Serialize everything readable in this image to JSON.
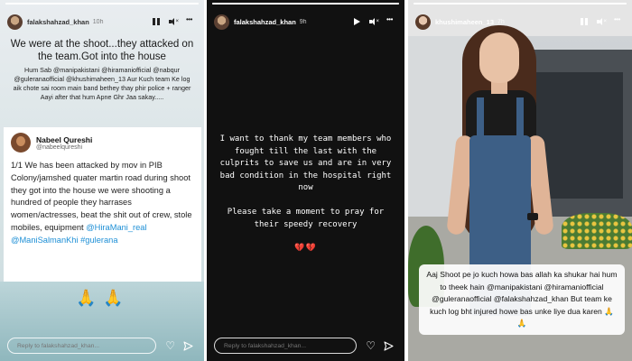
{
  "panel1": {
    "username": "falakshahzad_khan",
    "time": "10h",
    "headline": "We were at the shoot...they attacked on the team.Got into the house",
    "subtext": "Hum Sab @manipakistani @hiramaniofficial @nabqur @guleranaofficial @khushimaheen_13 Aur Kuch team Ke log aik chote sai room main band bethey thay phir police + ranger Aayi after that hum Apne Ghr Jaa sakay.....",
    "tweet": {
      "name": "Nabeel Qureshi",
      "handle": "@nabeelqureshi",
      "body": "1/1 We has been attacked by mov in PIB Colony/jamshed quater martin road during shoot they got into the house we were shooting a hundred of people they harrases women/actresses, beat the shit out of crew, stole mobiles, equipment",
      "mentions": "@HiraMani_real @ManiSalmanKhi #gulerana"
    },
    "emoji": "🙏🙏",
    "reply_placeholder": "Reply to falakshahzad_khan..."
  },
  "panel2": {
    "username": "falakshahzad_khan",
    "time": "9h",
    "para1": "I want to thank my team members who fought till the last with the culprits to save us and are in very bad condition in the hospital right now",
    "para2": "Please take a moment to pray for their speedy recovery",
    "hearts": "💔💔",
    "reply_placeholder": "Reply to falakshahzad_khan..."
  },
  "panel3": {
    "username": "khushimaheen_13",
    "time": "7h",
    "caption": "Aaj Shoot pe jo kuch howa bas allah ka shukar hai hum to theek hain @manipakistani @hiramaniofficial @guleranaofficial @falakshahzad_khan But team ke kuch log bht injured howe bas unke liye dua karen",
    "caption_emoji": "🙏🙏",
    "reply_placeholder": "Reply to khushimaheen_13..."
  },
  "colors": {
    "mention_blue": "#1d8fd6",
    "heart_red": "#e0302a"
  },
  "icons": [
    "pause-icon",
    "play-icon",
    "mute-icon",
    "more-icon",
    "heart-icon",
    "send-icon"
  ]
}
